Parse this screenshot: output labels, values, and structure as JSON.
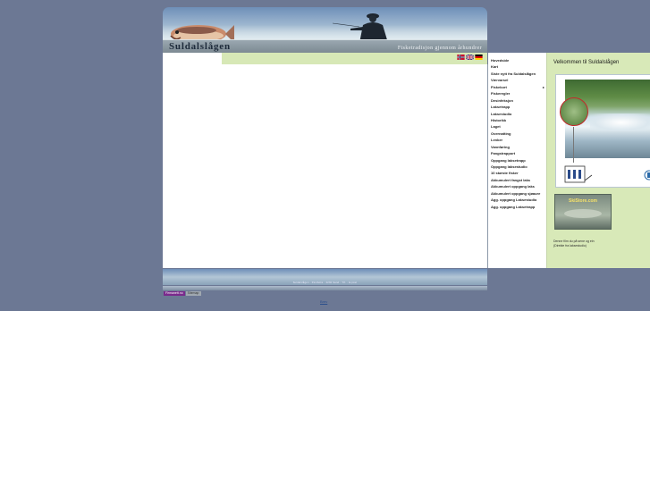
{
  "banner": {
    "title": "Suldalslågen",
    "slogan": "Fisketradisjon gjennom århundrer"
  },
  "flags": [
    {
      "name": "norway-flag-icon",
      "colors": [
        "#c8102e",
        "#ffffff",
        "#00205b"
      ]
    },
    {
      "name": "uk-flag-icon",
      "colors": [
        "#012169",
        "#ffffff",
        "#c8102e"
      ]
    },
    {
      "name": "germany-flag-icon",
      "colors": [
        "#000000",
        "#dd0000",
        "#ffce00"
      ]
    }
  ],
  "nav": {
    "items": [
      {
        "label": "Hovedside"
      },
      {
        "label": "Kart"
      },
      {
        "label": "Siste nytt fra Suldalslågen"
      },
      {
        "label": "Værvarsel"
      },
      {
        "label": "Fiskekort",
        "has_submenu": true
      },
      {
        "label": "Fiskeregler"
      },
      {
        "label": "Desinfeksjon"
      },
      {
        "label": "Laksetrapp"
      },
      {
        "label": "Laksestudio"
      },
      {
        "label": "Historikk"
      },
      {
        "label": "Laget"
      },
      {
        "label": "Overnatting"
      },
      {
        "label": "Lenker"
      },
      {
        "label": "Vannføring"
      },
      {
        "label": "Fangstrapport"
      },
      {
        "label": "Oppgang laksetrapp"
      },
      {
        "label": "Oppgang laksestudio"
      },
      {
        "label": "10 største fisker"
      },
      {
        "label": "Akkumulert fangst laks"
      },
      {
        "label": "Akkumulert oppgang laks"
      },
      {
        "label": "Akkumulert oppgang sjøaure"
      },
      {
        "label": "Agg. oppgang Laksestudio"
      },
      {
        "label": "Agg. oppgang Laksetrapp"
      }
    ]
  },
  "welcome": {
    "heading": "Velkommen til Suldalslågen",
    "text_line1": "Denne film du på sene og ein",
    "text_line2": "(Direkte fra laksestudio)"
  },
  "ad": {
    "brand": "SkiStore.com"
  },
  "footer": {
    "info": "Suldalslågen · Postboks · 4230 Sand · Tlf. · E-post",
    "badge_firmanett": "Firmanett.no",
    "badge_sitemap": "Sitemap",
    "bottom_link": "Brev"
  },
  "colors": {
    "page_background": "#6c7894",
    "nav_green": "#d8e9b8",
    "accent_red": "#c42b2b"
  }
}
